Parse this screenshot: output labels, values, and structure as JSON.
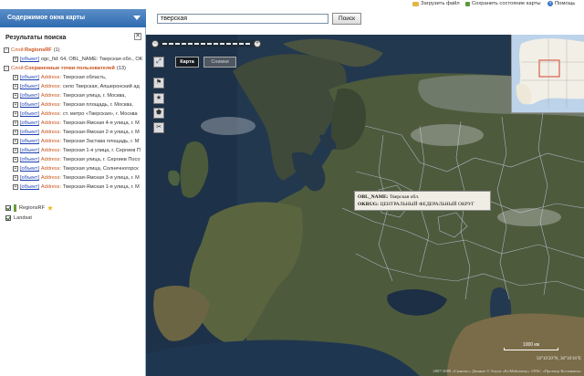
{
  "sidebar": {
    "header": "Содержимое окна карты",
    "title": "Результаты поиска",
    "close_glyph": "✕",
    "tree": [
      {
        "kind": "layer",
        "prefix": "Слой:",
        "label": "RegionsRF",
        "count": "(1)"
      },
      {
        "kind": "item",
        "obj": "[объект]",
        "text": "ogc_fid: 64, OBL_NAME: Тверская обл., OK"
      },
      {
        "kind": "layer",
        "prefix": "Слой:",
        "label": "Сохраненные точки пользователей",
        "count": "(13)"
      },
      {
        "kind": "item",
        "obj": "[объект]",
        "key": "Address:",
        "text": "Тверская область,"
      },
      {
        "kind": "item",
        "obj": "[объект]",
        "key": "Address:",
        "text": "село Тверская, Апшеронский ад"
      },
      {
        "kind": "item",
        "obj": "[объект]",
        "key": "Address:",
        "text": "Тверская улица, г. Москва,"
      },
      {
        "kind": "item",
        "obj": "[объект]",
        "key": "Address:",
        "text": "Тверская площадь, г. Москва,"
      },
      {
        "kind": "item",
        "obj": "[объект]",
        "key": "Address:",
        "text": "ст. метро «Тверская», г. Москва"
      },
      {
        "kind": "item",
        "obj": "[объект]",
        "key": "Address:",
        "text": "Тверская-Ямская 4-я улица, г. М"
      },
      {
        "kind": "item",
        "obj": "[объект]",
        "key": "Address:",
        "text": "Тверская-Ямская 2-я улица, г. М"
      },
      {
        "kind": "item",
        "obj": "[объект]",
        "key": "Address:",
        "text": "Тверская Застава площадь, г. М"
      },
      {
        "kind": "item",
        "obj": "[объект]",
        "key": "Address:",
        "text": "Тверская 1-я улица, г. Сергиев П"
      },
      {
        "kind": "item",
        "obj": "[объект]",
        "key": "Address:",
        "text": "Тверская улица, г. Сергиев Посо"
      },
      {
        "kind": "item",
        "obj": "[объект]",
        "key": "Address:",
        "text": "Тверская улица, Солнечногорск"
      },
      {
        "kind": "item",
        "obj": "[объект]",
        "key": "Address:",
        "text": "Тверская-Ямская 3-я улица, г. M"
      },
      {
        "kind": "item",
        "obj": "[объект]",
        "key": "Address:",
        "text": "Тверская-Ямская 1-я улица, г. M"
      }
    ],
    "layers": [
      {
        "label": "RegionsRF"
      },
      {
        "label": "Landsat"
      }
    ]
  },
  "search": {
    "value": "тверская",
    "button": "Поиск"
  },
  "toplinks": {
    "load": "Загрузить файл",
    "save": "Сохранить состояние карты",
    "help": "Помощь"
  },
  "map": {
    "tab_map": "Карта",
    "tab_sat": "Снимки",
    "tooltip": {
      "k1": "OBL_NAME:",
      "v1": "Тверская обл.",
      "k2": "OKRUG:",
      "v2": "ЦЕНТРАЛЬНЫЙ ФЕДЕРАЛЬНЫЙ ОКРУГ"
    },
    "scale": "1000 км",
    "coords": "56°10'20\"N, 36°10'16\"E",
    "copyright": "2007-2009 «Сканэкс» Данные © Soyuz «KoMaksiumy» ©РАС «Проектр Космиаша»"
  },
  "colors": {
    "header_bg": "#2f6bb0",
    "accent_orange": "#c8531c",
    "link_blue": "#1a3fb0"
  },
  "icons": {
    "zoom_minus": "−",
    "zoom_plus": "+",
    "help_glyph": "?",
    "tools": [
      "expand-icon",
      "flag-icon",
      "star-icon",
      "pentagon-icon",
      "scissors-icon"
    ],
    "tool_glyphs": [
      "⤢",
      "⚑",
      "★",
      "⬟",
      "✂"
    ]
  }
}
